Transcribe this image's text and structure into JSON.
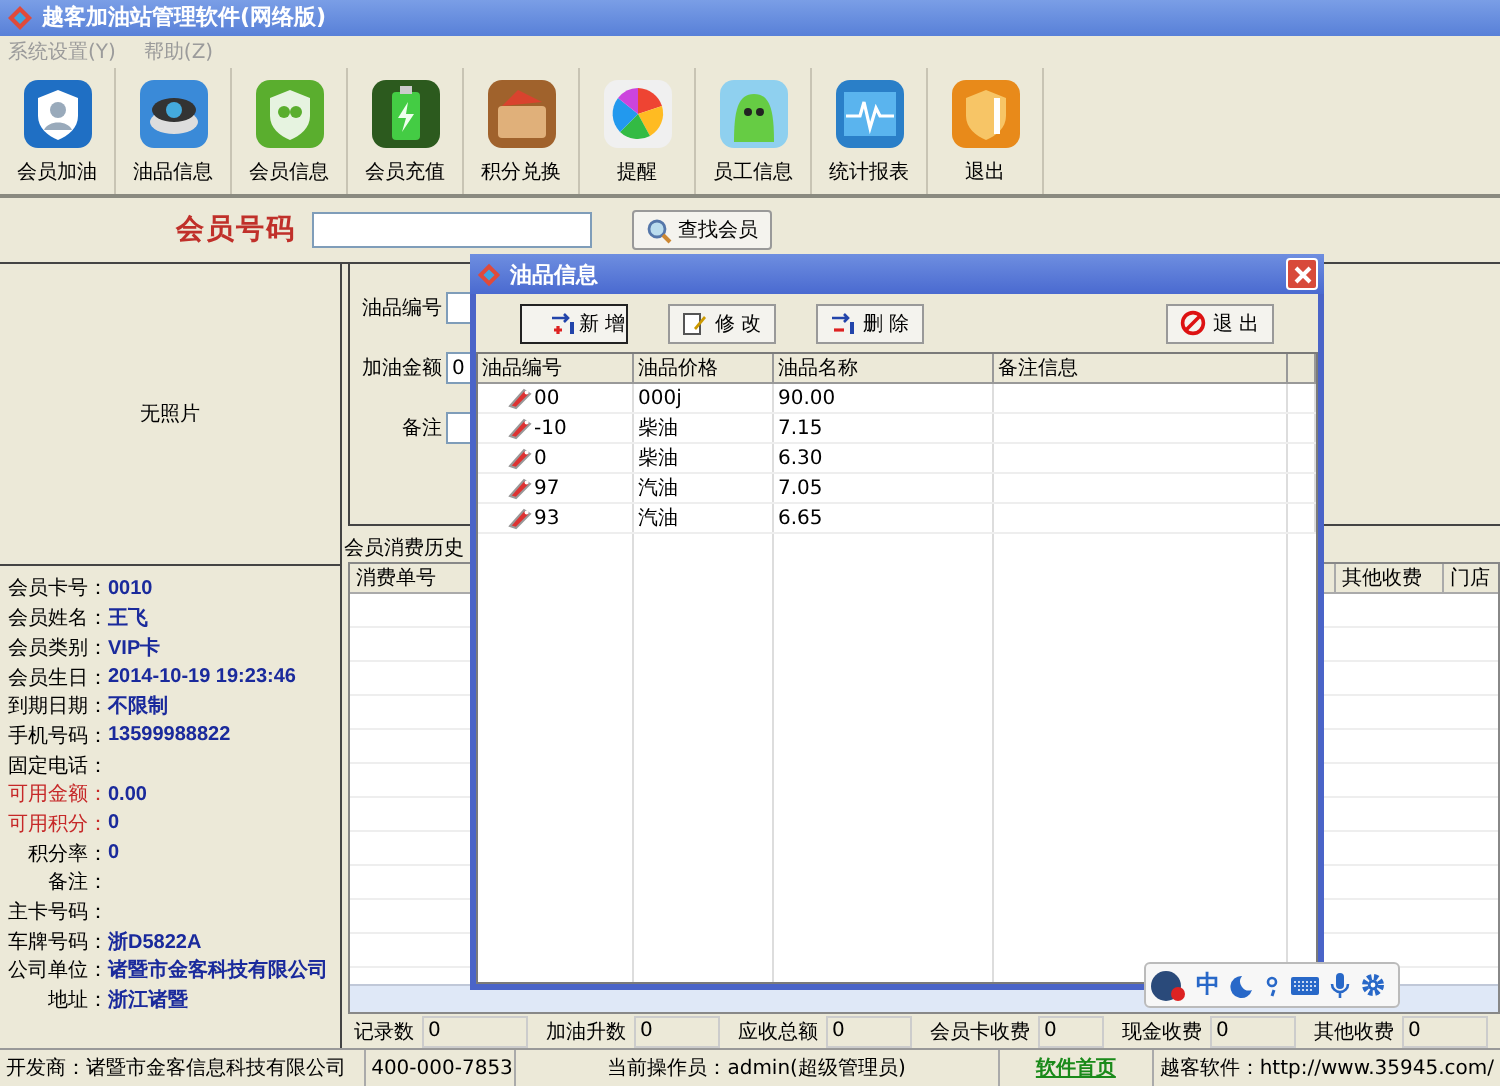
{
  "window": {
    "title": "越客加油站管理软件(网络版)"
  },
  "menu": [
    {
      "label": "系统设置(Y)",
      "disabled": true
    },
    {
      "label": "帮助(Z)",
      "disabled": true
    }
  ],
  "toolbar": [
    {
      "label": "会员加油"
    },
    {
      "label": "油品信息"
    },
    {
      "label": "会员信息"
    },
    {
      "label": "会员充值"
    },
    {
      "label": "积分兑换"
    },
    {
      "label": "提醒"
    },
    {
      "label": "员工信息"
    },
    {
      "label": "统计报表"
    },
    {
      "label": "退出"
    }
  ],
  "search": {
    "label": "会员号码",
    "button": "查找会员"
  },
  "photo": {
    "text": "无照片"
  },
  "member": [
    {
      "label": "会员卡号：",
      "value": "0010",
      "emphasis": false
    },
    {
      "label": "会员姓名：",
      "value": "王飞",
      "emphasis": false
    },
    {
      "label": "会员类别：",
      "value": "VIP卡",
      "emphasis": false
    },
    {
      "label": "会员生日：",
      "value": "2014-10-19 19:23:46",
      "emphasis": false
    },
    {
      "label": "到期日期：",
      "value": "不限制",
      "emphasis": false
    },
    {
      "label": "手机号码：",
      "value": "13599988822",
      "emphasis": false
    },
    {
      "label": "固定电话：",
      "emphasis": false
    },
    {
      "label": "可用金额：",
      "value": "0.00",
      "emphasis": true
    },
    {
      "label": "可用积分：",
      "value": "0",
      "emphasis": true
    },
    {
      "label": "积分率：",
      "value": "0",
      "emphasis": false
    },
    {
      "label": "备注：",
      "emphasis": false
    },
    {
      "label": "主卡号码：",
      "emphasis": false
    },
    {
      "label": "车牌号码：",
      "value": "浙D5822A",
      "emphasis": false
    },
    {
      "label": "公司单位：",
      "value": "诸暨市金客科技有限公司",
      "emphasis": false
    },
    {
      "label": "地址：",
      "value": "浙江诸暨",
      "emphasis": false
    }
  ],
  "form": [
    {
      "label": "油品编号"
    },
    {
      "label": "加油金额",
      "value": "0"
    },
    {
      "label": "备注"
    }
  ],
  "history_tab": {
    "label": "会员消费历史"
  },
  "history_table": {
    "columns": [
      "消费单号",
      "其他收费",
      "门店"
    ]
  },
  "summary": [
    {
      "label": "记录数",
      "value": "0"
    },
    {
      "label": "加油升数",
      "value": "0"
    },
    {
      "label": "应收总额",
      "value": "0"
    },
    {
      "label": "会员卡收费",
      "value": "0"
    },
    {
      "label": "现金收费",
      "value": "0"
    },
    {
      "label": "其他收费",
      "value": "0"
    }
  ],
  "status_bar": {
    "developer": "开发商：诸暨市金客信息科技有限公司",
    "phone": "400-000-7853",
    "operator": "当前操作员：admin(超级管理员)",
    "home_link": "软件首页",
    "website": "越客软件：http://www.35945.com/"
  },
  "dialog": {
    "title": "油品信息",
    "buttons": [
      {
        "label": "新 增",
        "kind": "add"
      },
      {
        "label": "修 改",
        "kind": "edit"
      },
      {
        "label": "删 除",
        "kind": "delete"
      },
      {
        "label": "退 出",
        "kind": "exit"
      }
    ],
    "columns": [
      "油品编号",
      "油品价格",
      "油品名称",
      "备注信息"
    ],
    "rows": [
      [
        "00",
        "000j",
        "90.00",
        ""
      ],
      [
        "-10",
        "柴油",
        "7.15",
        ""
      ],
      [
        "0",
        "柴油",
        "6.30",
        ""
      ],
      [
        "97",
        "汽油",
        "7.05",
        ""
      ],
      [
        "93",
        "汽油",
        "6.65",
        ""
      ]
    ]
  },
  "ime_bar": {
    "mode": "中"
  }
}
